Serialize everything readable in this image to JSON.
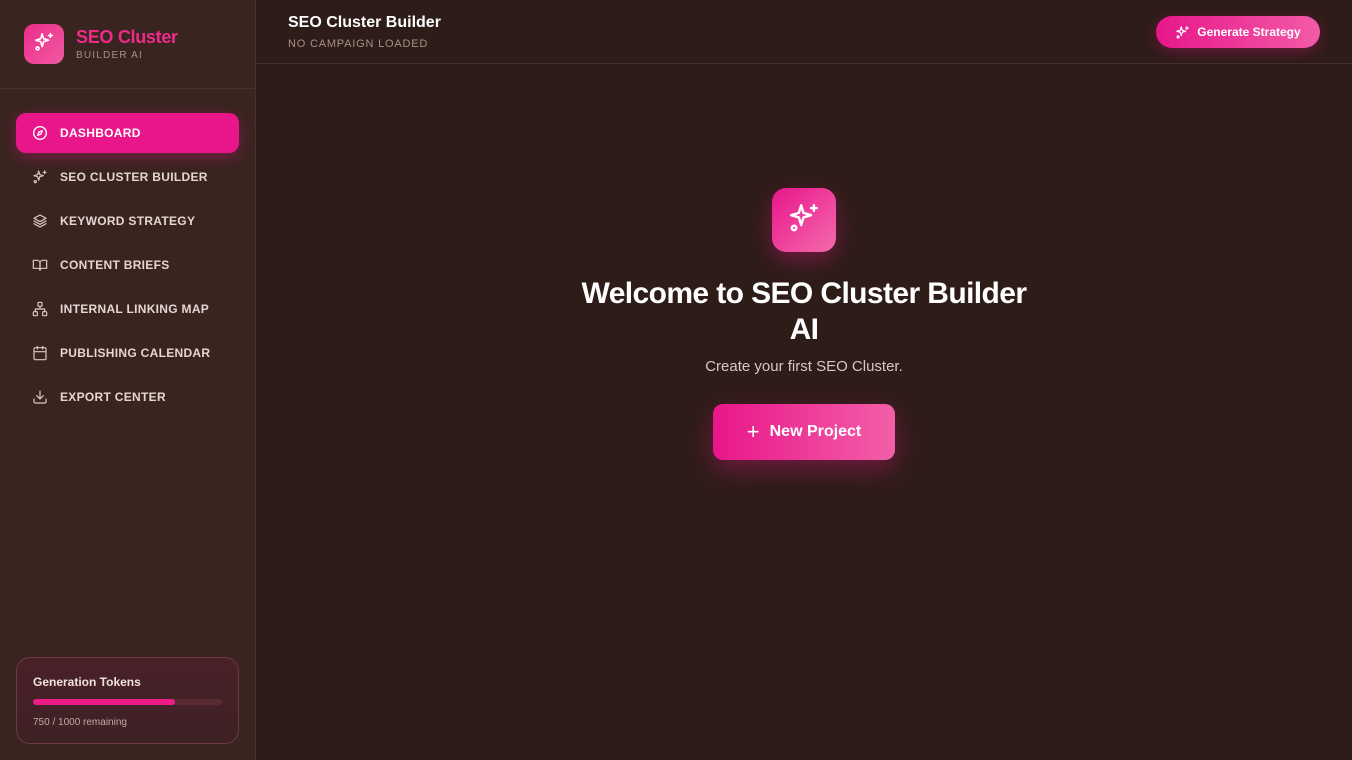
{
  "brand": {
    "title": "SEO Cluster",
    "subtitle": "BUILDER AI",
    "icon": "sparkles-icon"
  },
  "sidebar": {
    "items": [
      {
        "label": "DASHBOARD",
        "icon": "compass-icon",
        "active": true
      },
      {
        "label": "SEO CLUSTER BUILDER",
        "icon": "sparkles-icon"
      },
      {
        "label": "KEYWORD STRATEGY",
        "icon": "layers-icon"
      },
      {
        "label": "CONTENT BRIEFS",
        "icon": "book-open-icon"
      },
      {
        "label": "INTERNAL LINKING MAP",
        "icon": "network-icon"
      },
      {
        "label": "PUBLISHING CALENDAR",
        "icon": "calendar-icon"
      },
      {
        "label": "EXPORT CENTER",
        "icon": "download-icon"
      }
    ],
    "tokens": {
      "title": "Generation Tokens",
      "remaining_text": "750 / 1000 remaining",
      "used_fraction": 0.75
    }
  },
  "header": {
    "title": "SEO Cluster Builder",
    "subtitle": "NO CAMPAIGN LOADED",
    "generate_label": "Generate Strategy"
  },
  "hero": {
    "title": "Welcome to SEO Cluster Builder AI",
    "subtitle": "Create your first SEO Cluster.",
    "new_project_label": "New Project"
  },
  "colors": {
    "accent": "#e8168a",
    "background": "#2e1c18",
    "sidebar": "#3a241f"
  }
}
